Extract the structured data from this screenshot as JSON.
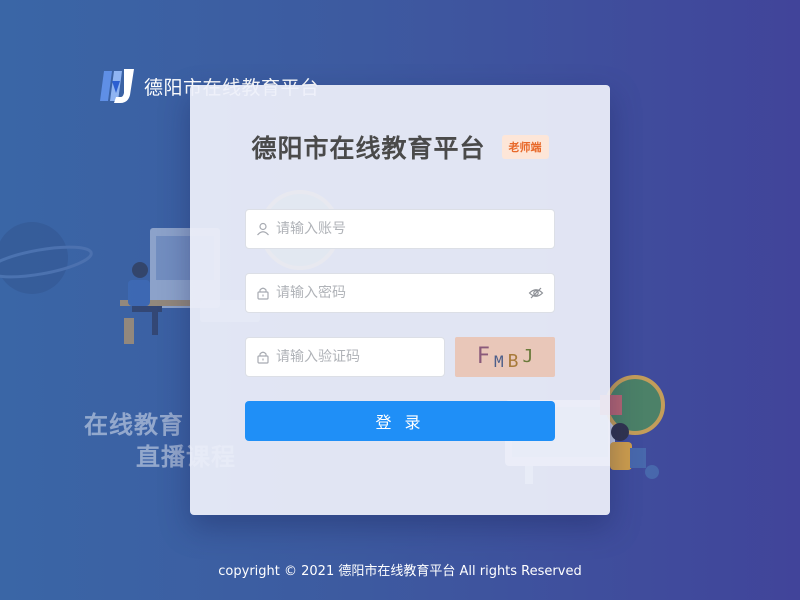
{
  "header": {
    "title": "德阳市在线教育平台"
  },
  "background": {
    "slogan_line1": "在线教育",
    "slogan_line2": "直播课程"
  },
  "card": {
    "title": "德阳市在线教育平台",
    "role_badge": "老师端",
    "account": {
      "placeholder": "请输入账号",
      "value": ""
    },
    "password": {
      "placeholder": "请输入密码",
      "value": ""
    },
    "captcha": {
      "placeholder": "请输入验证码",
      "value": "",
      "chars": [
        {
          "ch": "F",
          "color": "#8a5a7a"
        },
        {
          "ch": "M",
          "color": "#4d5f8a"
        },
        {
          "ch": "B",
          "color": "#a87a3a"
        },
        {
          "ch": "J",
          "color": "#6a7a3a"
        }
      ]
    },
    "login_label": "登 录"
  },
  "footer": {
    "copyright": "copyright © 2021 德阳市在线教育平台 All rights Reserved"
  },
  "colors": {
    "primary": "#1f8ff7",
    "badge_bg": "#fde6d8",
    "badge_text": "#e8692a"
  }
}
